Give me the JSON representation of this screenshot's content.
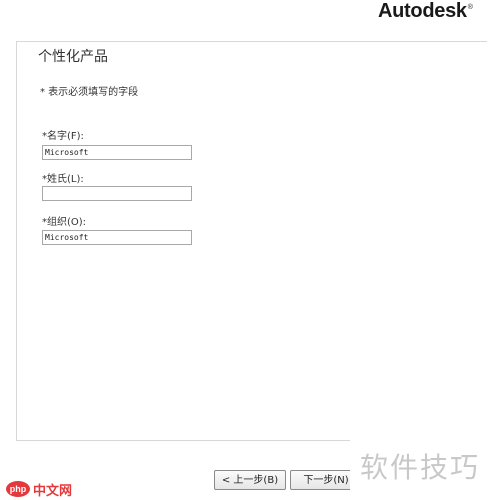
{
  "brand": {
    "logo_text": "Autodesk",
    "trademark": "®"
  },
  "page": {
    "title": "个性化产品",
    "required_note": "* 表示必须填写的字段"
  },
  "form": {
    "first_name": {
      "label": "*名字(F):",
      "value": "Microsoft"
    },
    "last_name": {
      "label": "*姓氏(L):",
      "value": ""
    },
    "organization": {
      "label": "*组织(O):",
      "value": "Microsoft"
    }
  },
  "buttons": {
    "back": "< 上一步(B)",
    "next": "下一步(N)"
  },
  "watermarks": {
    "right_text": "软件技巧",
    "php_badge": "php",
    "left_text": "中文网"
  },
  "colors": {
    "accent_red": "#e4393c",
    "border": "#a8a8a8"
  }
}
